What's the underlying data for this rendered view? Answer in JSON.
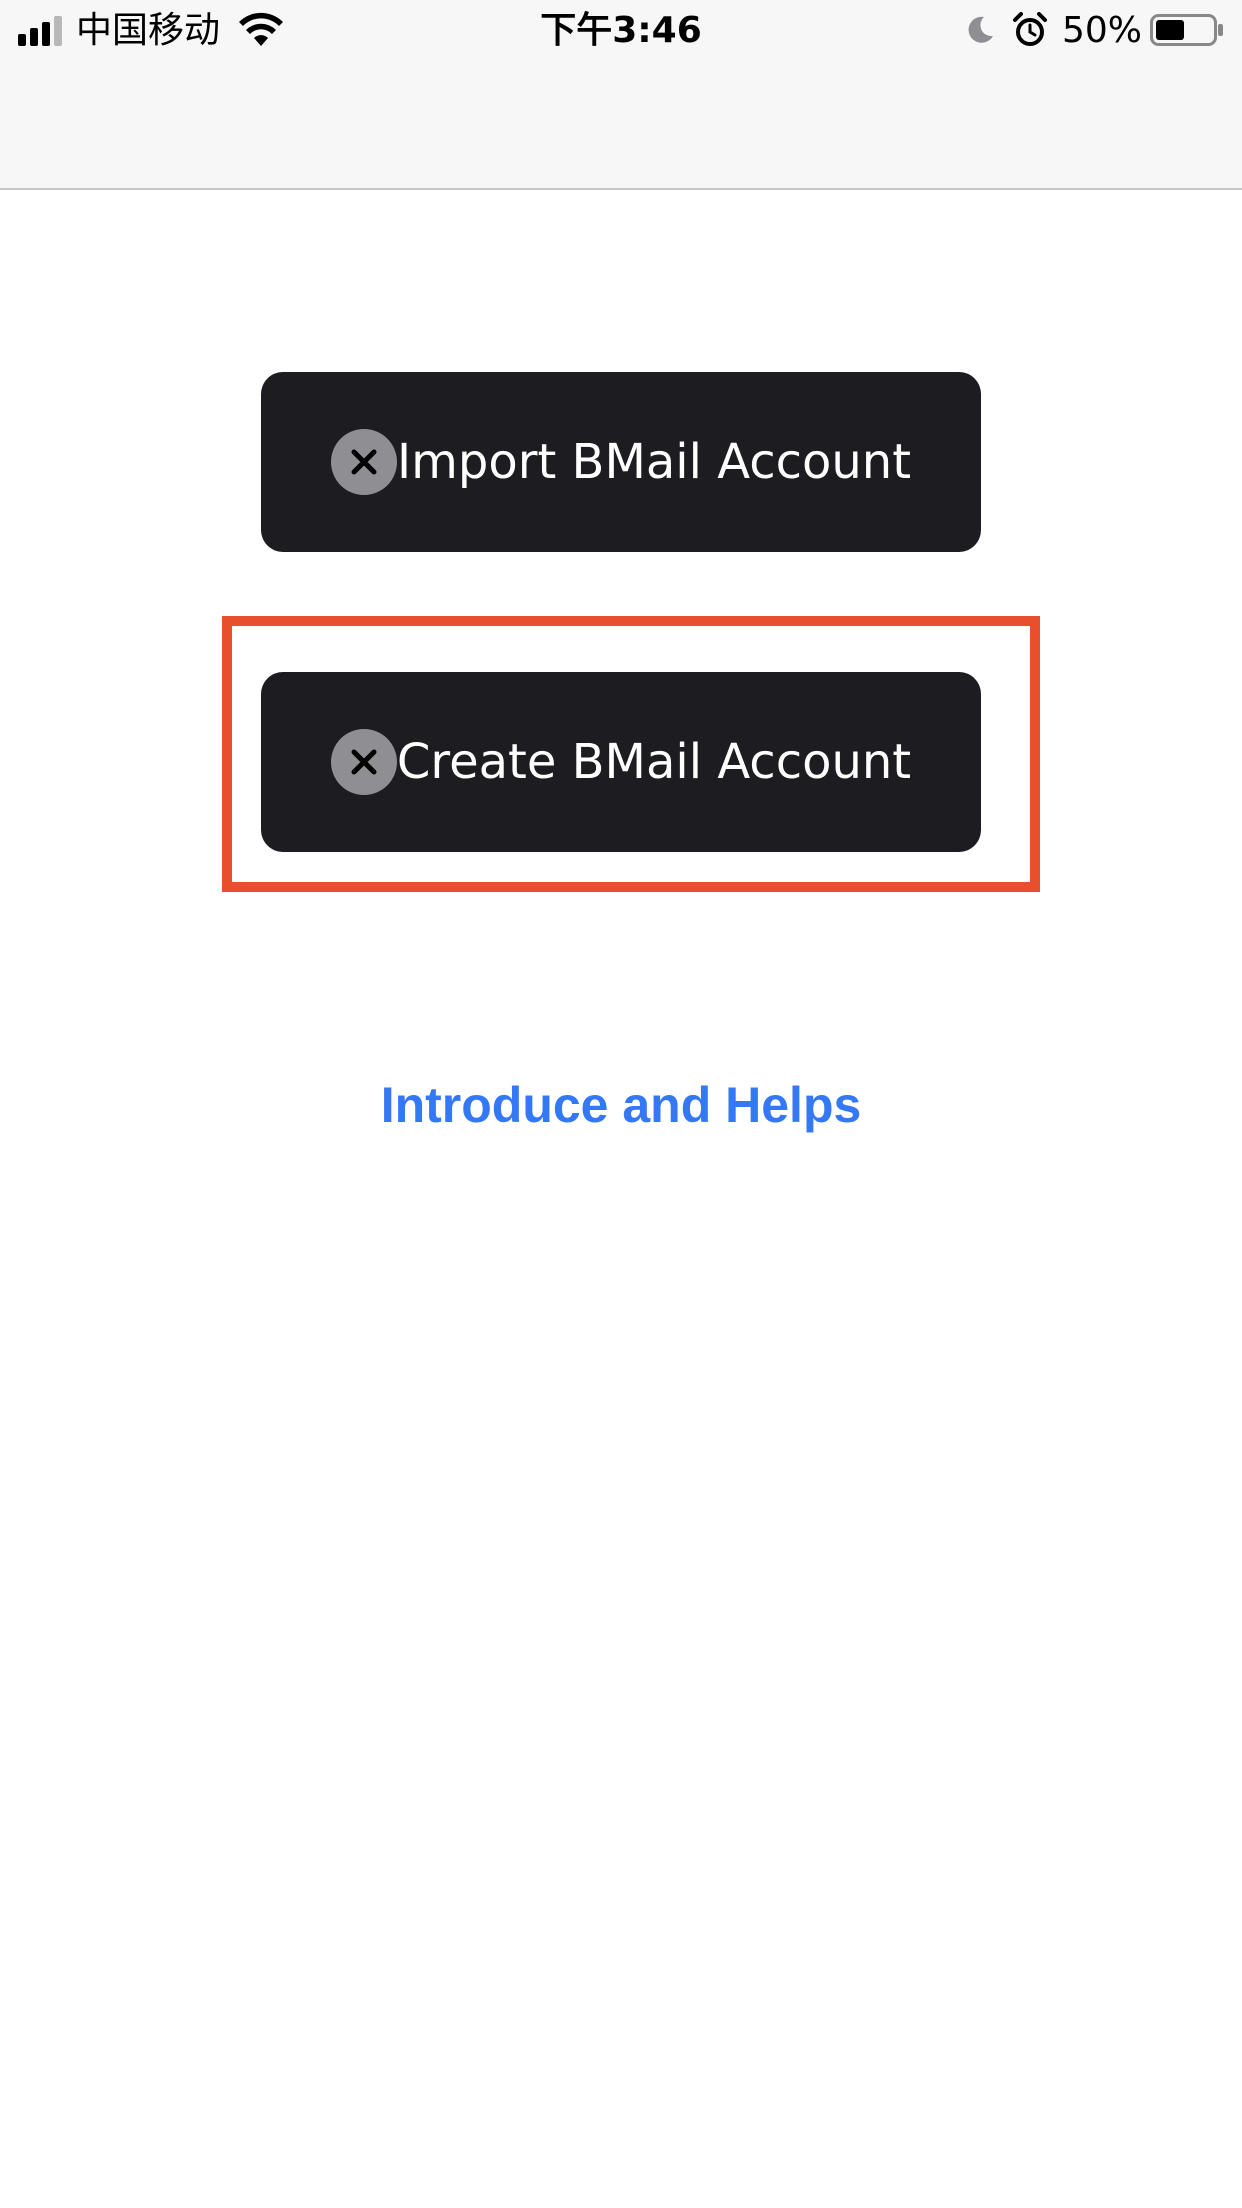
{
  "status_bar": {
    "carrier": "中国移动",
    "time": "下午3:46",
    "battery_percent": "50%",
    "battery_level": 0.5,
    "icons": [
      "signal-icon",
      "wifi-icon",
      "moon-icon",
      "alarm-icon",
      "battery-icon"
    ]
  },
  "buttons": {
    "import_label": "Import BMail Account",
    "create_label": "Create BMail Account",
    "icon": "close-circle-icon"
  },
  "help": {
    "label": "Introduce and Helps"
  },
  "colors": {
    "button_bg": "#1c1c21",
    "icon_circle": "#8e8e93",
    "highlight": "#e8502d",
    "link": "#3478f6",
    "nav_bg": "#f7f7f7"
  }
}
